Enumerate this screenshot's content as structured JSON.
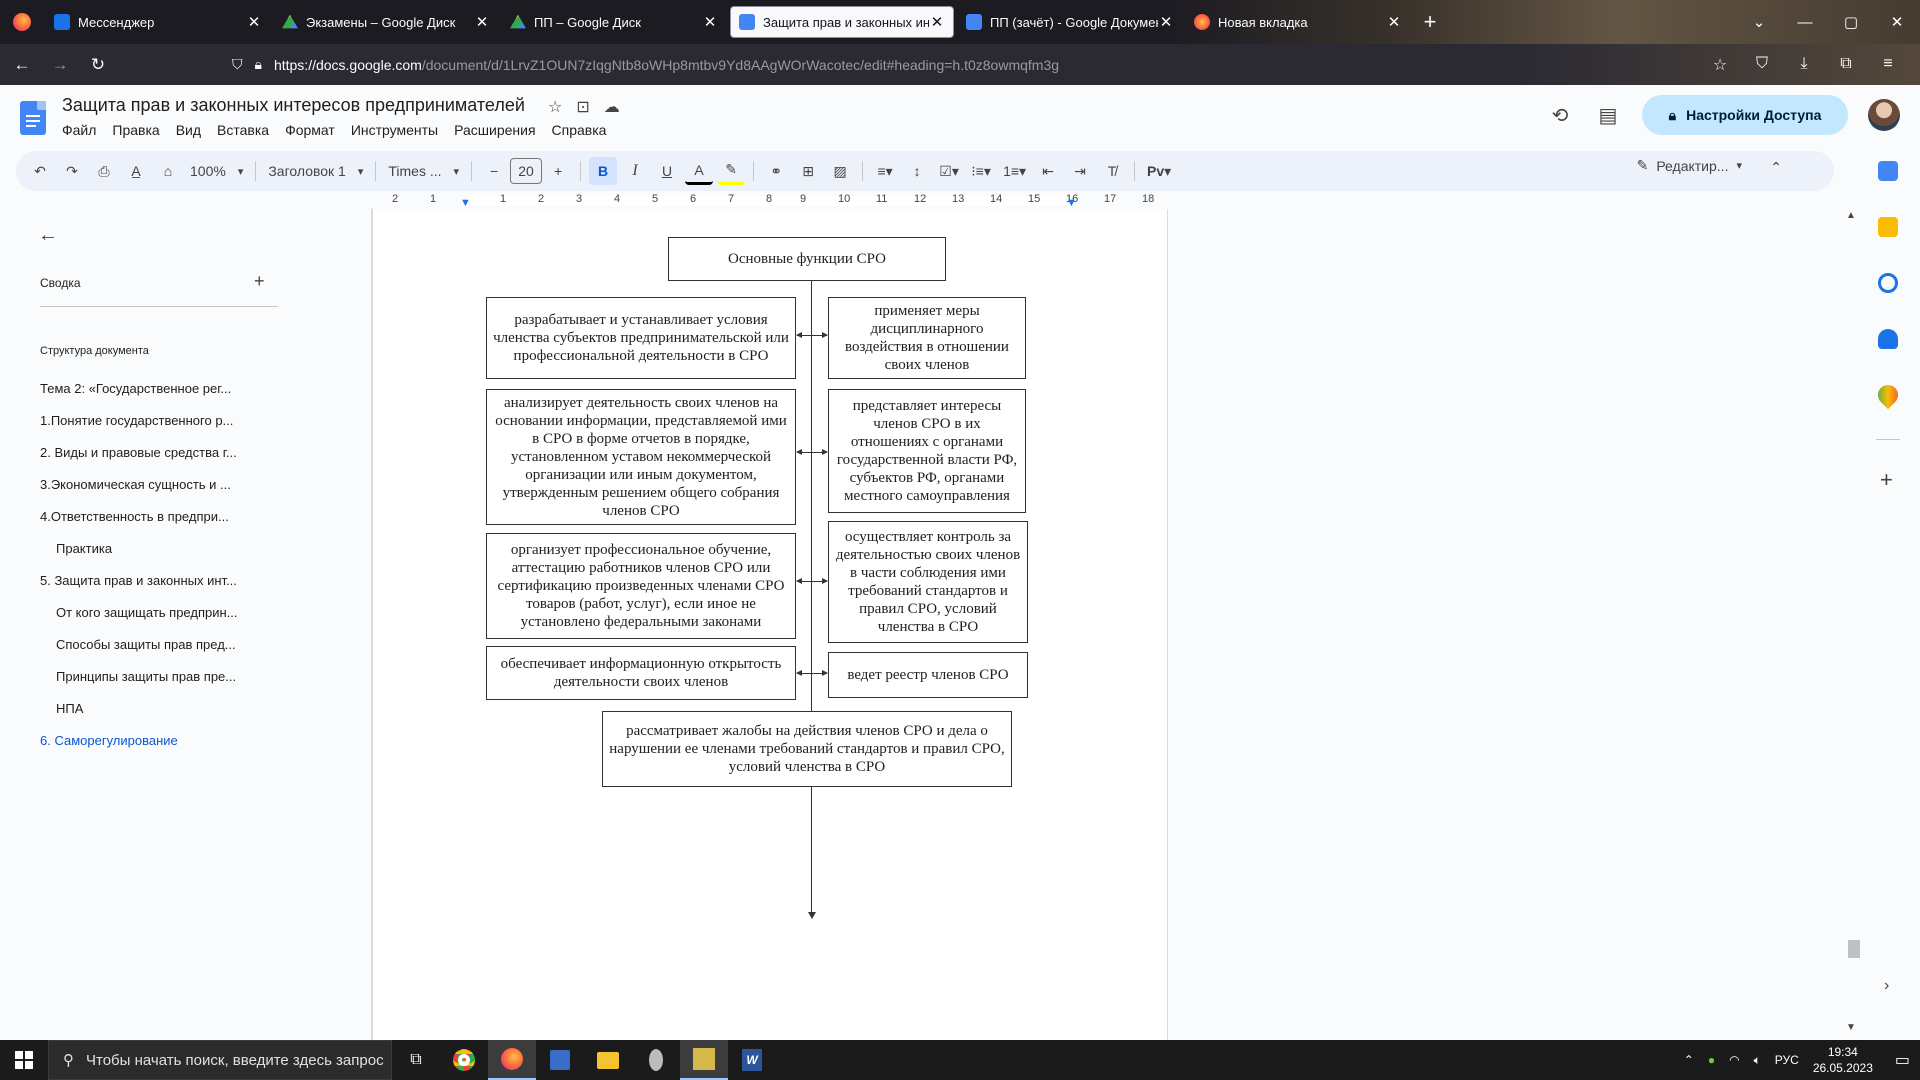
{
  "browser": {
    "tabs": [
      {
        "title": "Мессенджер",
        "icon": "messenger-icon",
        "color": "#1a73e8",
        "active": false
      },
      {
        "title": "Экзамены – Google Диск",
        "icon": "drive-icon",
        "color": "#34a853",
        "active": false
      },
      {
        "title": "ПП – Google Диск",
        "icon": "drive-icon",
        "color": "#34a853",
        "active": false
      },
      {
        "title": "Защита прав и законных инте",
        "icon": "docs-icon",
        "color": "#4285f4",
        "active": true
      },
      {
        "title": "ПП (зачёт) - Google Документ",
        "icon": "docs-icon",
        "color": "#4285f4",
        "active": false
      },
      {
        "title": "Новая вкладка",
        "icon": "firefox-icon",
        "color": "#ff7139",
        "active": false
      }
    ],
    "url_host": "https://docs.google.com",
    "url_rest": "/document/d/1LrvZ1OUN7zIqgNtb8oWHp8mtbv9Yd8AAgWOrWacotec/edit#heading=h.t0z8owmqfm3g"
  },
  "doc": {
    "title": "Защита прав и законных интересов предпринимателей",
    "menu": [
      "Файл",
      "Правка",
      "Вид",
      "Вставка",
      "Формат",
      "Инструменты",
      "Расширения",
      "Справка"
    ],
    "share_label": "Настройки Доступа"
  },
  "toolbar": {
    "zoom": "100%",
    "style": "Заголовок 1",
    "font": "Times ...",
    "font_size": "20",
    "mode": "Редактир..."
  },
  "outline": {
    "summary_label": "Сводка",
    "structure_label": "Структура документа",
    "items": [
      {
        "text": "Тема 2: «Государственное рег...",
        "level": 1,
        "active": false
      },
      {
        "text": "1.Понятие государственного р...",
        "level": 1,
        "active": false
      },
      {
        "text": "2. Виды и правовые средства г...",
        "level": 1,
        "active": false
      },
      {
        "text": "3.Экономическая сущность и ...",
        "level": 1,
        "active": false
      },
      {
        "text": "4.Ответственность в предпри...",
        "level": 1,
        "active": false
      },
      {
        "text": "Практика",
        "level": 2,
        "active": false
      },
      {
        "text": "5. Защита прав и законных инт...",
        "level": 1,
        "active": false
      },
      {
        "text": "От кого защищать предприн...",
        "level": 2,
        "active": false
      },
      {
        "text": "Способы защиты прав пред...",
        "level": 2,
        "active": false
      },
      {
        "text": "Принципы защиты прав пре...",
        "level": 2,
        "active": false
      },
      {
        "text": "НПА",
        "level": 2,
        "active": false
      },
      {
        "text": "6. Саморегулирование",
        "level": 1,
        "active": true
      }
    ]
  },
  "ruler": [
    "2",
    "1",
    "1",
    "2",
    "3",
    "4",
    "5",
    "6",
    "7",
    "8",
    "9",
    "10",
    "11",
    "12",
    "13",
    "14",
    "15",
    "16",
    "17",
    "18"
  ],
  "diagram": {
    "top": "Основные функции СРО",
    "left": [
      "разрабатывает и устанавливает условия членства субъектов предпринимательской или профессиональной деятельности в СРО",
      "анализирует деятельность своих членов на основании информации, представляемой ими в СРО в форме отчетов в порядке, установленном уставом некоммерческой организации или иным документом, утвержденным решением общего собрания членов СРО",
      "организует профессиональное обучение, аттестацию работников членов СРО или сертификацию произведенных членами СРО товаров (работ, услуг), если иное не установлено федеральными законами",
      "обеспечивает информационную открытость деятельности своих членов"
    ],
    "right": [
      "применяет меры дисциплинарного воздействия в отношении своих членов",
      "представляет интересы членов СРО в их отношениях с органами государственной власти РФ, субъектов РФ, органами местного самоуправления",
      "осуществляет контроль за деятельностью своих членов в части соблюдения ими требований стандартов и правил СРО, условий членства в СРО",
      "ведет реестр членов СРО"
    ],
    "bottom": "рассматривает жалобы на действия членов СРО и дела о нарушении ее членами требований стандартов и правил СРО, условий членства в СРО"
  },
  "taskbar": {
    "search_placeholder": "Чтобы начать поиск, введите здесь запрос",
    "lang": "РУС",
    "time": "19:34",
    "date": "26.05.2023"
  }
}
